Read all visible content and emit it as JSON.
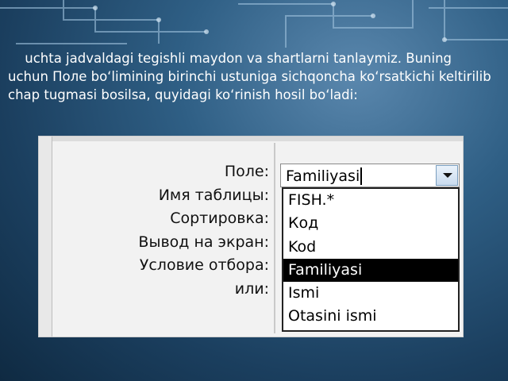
{
  "caption": {
    "bullet": "",
    "text": "uchta jadvaldagi tegishli maydon va shartlarni tanlaymiz. Buning uchun Поле bo‘limining birinchi ustuniga sichqoncha ko‘rsatkichi keltirilib chap tugmasi bosilsa, quyidagi ko‘rinish hosil bo‘ladi:"
  },
  "grid": {
    "labels": [
      "Поле:",
      "Имя таблицы:",
      "Сортировка:",
      "Вывод на экран:",
      "Условие отбора:",
      "или:"
    ]
  },
  "field_combo": {
    "value": "Familiyasi",
    "options": [
      "FISH.*",
      "Код",
      "Kod",
      "Familiyasi",
      "Ismi",
      "Otasini ismi"
    ],
    "selected_index": 3
  },
  "colors": {
    "background": "#1b3f5f",
    "selection": "#000000"
  }
}
